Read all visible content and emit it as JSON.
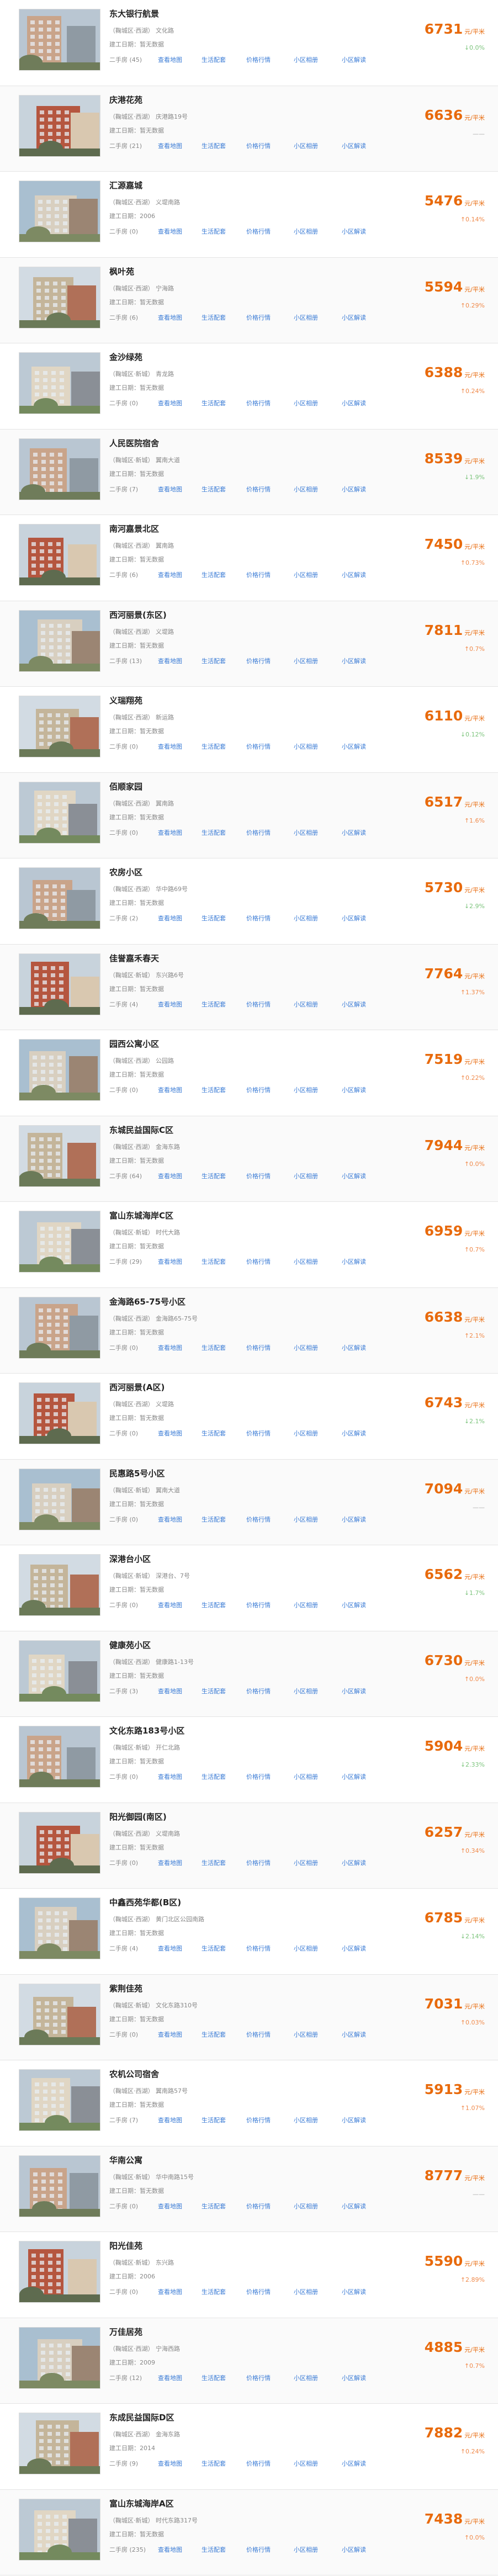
{
  "ui": {
    "built_label": "建工日期：",
    "price_unit": "元/平米",
    "secondhand_label": "二手房",
    "links": [
      "查看地图",
      "生活配套",
      "价格行情",
      "小区相册",
      "小区解读"
    ]
  },
  "communities": [
    {
      "name": "东大银行航景",
      "district": "（鞠城区·西湖）",
      "street": "文化路",
      "built": "暂无数据",
      "count": "(45)",
      "price": "6731",
      "change": "↓0.0%",
      "trend": "down"
    },
    {
      "name": "庆港花苑",
      "district": "（鞠城区·西湖）",
      "street": "庆港路19号",
      "built": "暂无数据",
      "count": "(21)",
      "price": "6636",
      "change": "——",
      "trend": "flat"
    },
    {
      "name": "汇源嘉城",
      "district": "（鞠城区·西湖）",
      "street": "义堤南路",
      "built": "2006",
      "count": "(0)",
      "price": "5476",
      "change": "↑0.14%",
      "trend": "up"
    },
    {
      "name": "枫叶苑",
      "district": "（鞠城区·西湖）",
      "street": "宁海路",
      "built": "暂无数据",
      "count": "(6)",
      "price": "5594",
      "change": "↑0.29%",
      "trend": "up"
    },
    {
      "name": "金沙绿苑",
      "district": "（鞠城区·新城）",
      "street": "青龙路",
      "built": "暂无数据",
      "count": "(0)",
      "price": "6388",
      "change": "↑0.24%",
      "trend": "up"
    },
    {
      "name": "人民医院宿舍",
      "district": "（鞠城区·新城）",
      "street": "翼南大道",
      "built": "暂无数据",
      "count": "(7)",
      "price": "8539",
      "change": "↓1.9%",
      "trend": "down"
    },
    {
      "name": "南河嘉景北区",
      "district": "（鞠城区·西湖）",
      "street": "翼南路",
      "built": "暂无数据",
      "count": "(6)",
      "price": "7450",
      "change": "↑0.73%",
      "trend": "up"
    },
    {
      "name": "西河丽景(东区)",
      "district": "（鞠城区·西湖）",
      "street": "义堤路",
      "built": "暂无数据",
      "count": "(13)",
      "price": "7811",
      "change": "↑0.7%",
      "trend": "up"
    },
    {
      "name": "义瑞翔苑",
      "district": "（鞠城区·西湖）",
      "street": "新运路",
      "built": "暂无数据",
      "count": "(0)",
      "price": "6110",
      "change": "↓0.12%",
      "trend": "down"
    },
    {
      "name": "佰顺家园",
      "district": "（鞠城区·西湖）",
      "street": "翼南路",
      "built": "暂无数据",
      "count": "(0)",
      "price": "6517",
      "change": "↑1.6%",
      "trend": "up"
    },
    {
      "name": "农房小区",
      "district": "（鞠城区·西湖）",
      "street": "华中路69号",
      "built": "暂无数据",
      "count": "(2)",
      "price": "5730",
      "change": "↓2.9%",
      "trend": "down"
    },
    {
      "name": "佳誉嘉禾春天",
      "district": "（鞠城区·新城）",
      "street": "东兴路6号",
      "built": "暂无数据",
      "count": "(4)",
      "price": "7764",
      "change": "↑1.37%",
      "trend": "up"
    },
    {
      "name": "园西公寓小区",
      "district": "（鞠城区·西湖）",
      "street": "公园路",
      "built": "暂无数据",
      "count": "(0)",
      "price": "7519",
      "change": "↑0.22%",
      "trend": "up"
    },
    {
      "name": "东城民益国际C区",
      "district": "（鞠城区·西湖）",
      "street": "金海东路",
      "built": "暂无数据",
      "count": "(64)",
      "price": "7944",
      "change": "↑0.0%",
      "trend": "up"
    },
    {
      "name": "富山东城海岸C区",
      "district": "（鞠城区·新城）",
      "street": "时代大路",
      "built": "暂无数据",
      "count": "(29)",
      "price": "6959",
      "change": "↑0.7%",
      "trend": "up"
    },
    {
      "name": "金海路65-75号小区",
      "district": "（鞠城区·西湖）",
      "street": "金海路65-75号",
      "built": "暂无数据",
      "count": "(0)",
      "price": "6638",
      "change": "↑2.1%",
      "trend": "up"
    },
    {
      "name": "西河丽景(A区)",
      "district": "（鞠城区·西湖）",
      "street": "义堤路",
      "built": "暂无数据",
      "count": "(0)",
      "price": "6743",
      "change": "↓2.1%",
      "trend": "down"
    },
    {
      "name": "民惠路5号小区",
      "district": "（鞠城区·新城）",
      "street": "翼南大道",
      "built": "暂无数据",
      "count": "(0)",
      "price": "7094",
      "change": "——",
      "trend": "flat"
    },
    {
      "name": "深港台小区",
      "district": "（鞠城区·新城）",
      "street": "深港台、7号",
      "built": "暂无数据",
      "count": "(0)",
      "price": "6562",
      "change": "↓1.7%",
      "trend": "down"
    },
    {
      "name": "健康苑小区",
      "district": "（鞠城区·西湖）",
      "street": "健康路1-13号",
      "built": "暂无数据",
      "count": "(3)",
      "price": "6730",
      "change": "↑0.0%",
      "trend": "up"
    },
    {
      "name": "文化东路183号小区",
      "district": "（鞠城区·新城）",
      "street": "开仁北路",
      "built": "暂无数据",
      "count": "(0)",
      "price": "5904",
      "change": "↓2.33%",
      "trend": "down"
    },
    {
      "name": "阳光御园(南区)",
      "district": "（鞠城区·西湖）",
      "street": "义堤南路",
      "built": "暂无数据",
      "count": "(0)",
      "price": "6257",
      "change": "↑0.34%",
      "trend": "up"
    },
    {
      "name": "中鑫西苑华都(B区)",
      "district": "（鞠城区·西湖）",
      "street": "黄门北区公园南路",
      "built": "暂无数据",
      "count": "(4)",
      "price": "6785",
      "change": "↓2.14%",
      "trend": "down"
    },
    {
      "name": "紫荆佳苑",
      "district": "（鞠城区·新城）",
      "street": "文化东路310号",
      "built": "暂无数据",
      "count": "(0)",
      "price": "7031",
      "change": "↑0.03%",
      "trend": "up"
    },
    {
      "name": "农机公司宿舍",
      "district": "（鞠城区·西湖）",
      "street": "翼南路57号",
      "built": "暂无数据",
      "count": "(7)",
      "price": "5913",
      "change": "↑1.07%",
      "trend": "up"
    },
    {
      "name": "华南公寓",
      "district": "（鞠城区·新城）",
      "street": "华中南路15号",
      "built": "暂无数据",
      "count": "(0)",
      "price": "8777",
      "change": "——",
      "trend": "flat"
    },
    {
      "name": "阳光佳苑",
      "district": "（鞠城区·新城）",
      "street": "东兴路",
      "built": "2006",
      "count": "(0)",
      "price": "5590",
      "change": "↑2.89%",
      "trend": "up"
    },
    {
      "name": "万佳居苑",
      "district": "（鞠城区·西湖）",
      "street": "宁海西路",
      "built": "2009",
      "count": "(12)",
      "price": "4885",
      "change": "↑0.7%",
      "trend": "up"
    },
    {
      "name": "东成民益国际D区",
      "district": "（鞠城区·西湖）",
      "street": "金海东路",
      "built": "2014",
      "count": "(9)",
      "price": "7882",
      "change": "↑0.24%",
      "trend": "up"
    },
    {
      "name": "富山东城海岸A区",
      "district": "（鞠城区·新城）",
      "street": "时代东路317号",
      "built": "暂无数据",
      "count": "(235)",
      "price": "7438",
      "change": "↑0.0%",
      "trend": "up"
    }
  ],
  "colors": {
    "price": "#e86a0c",
    "link": "#3a7bd5",
    "muted": "#888888"
  }
}
